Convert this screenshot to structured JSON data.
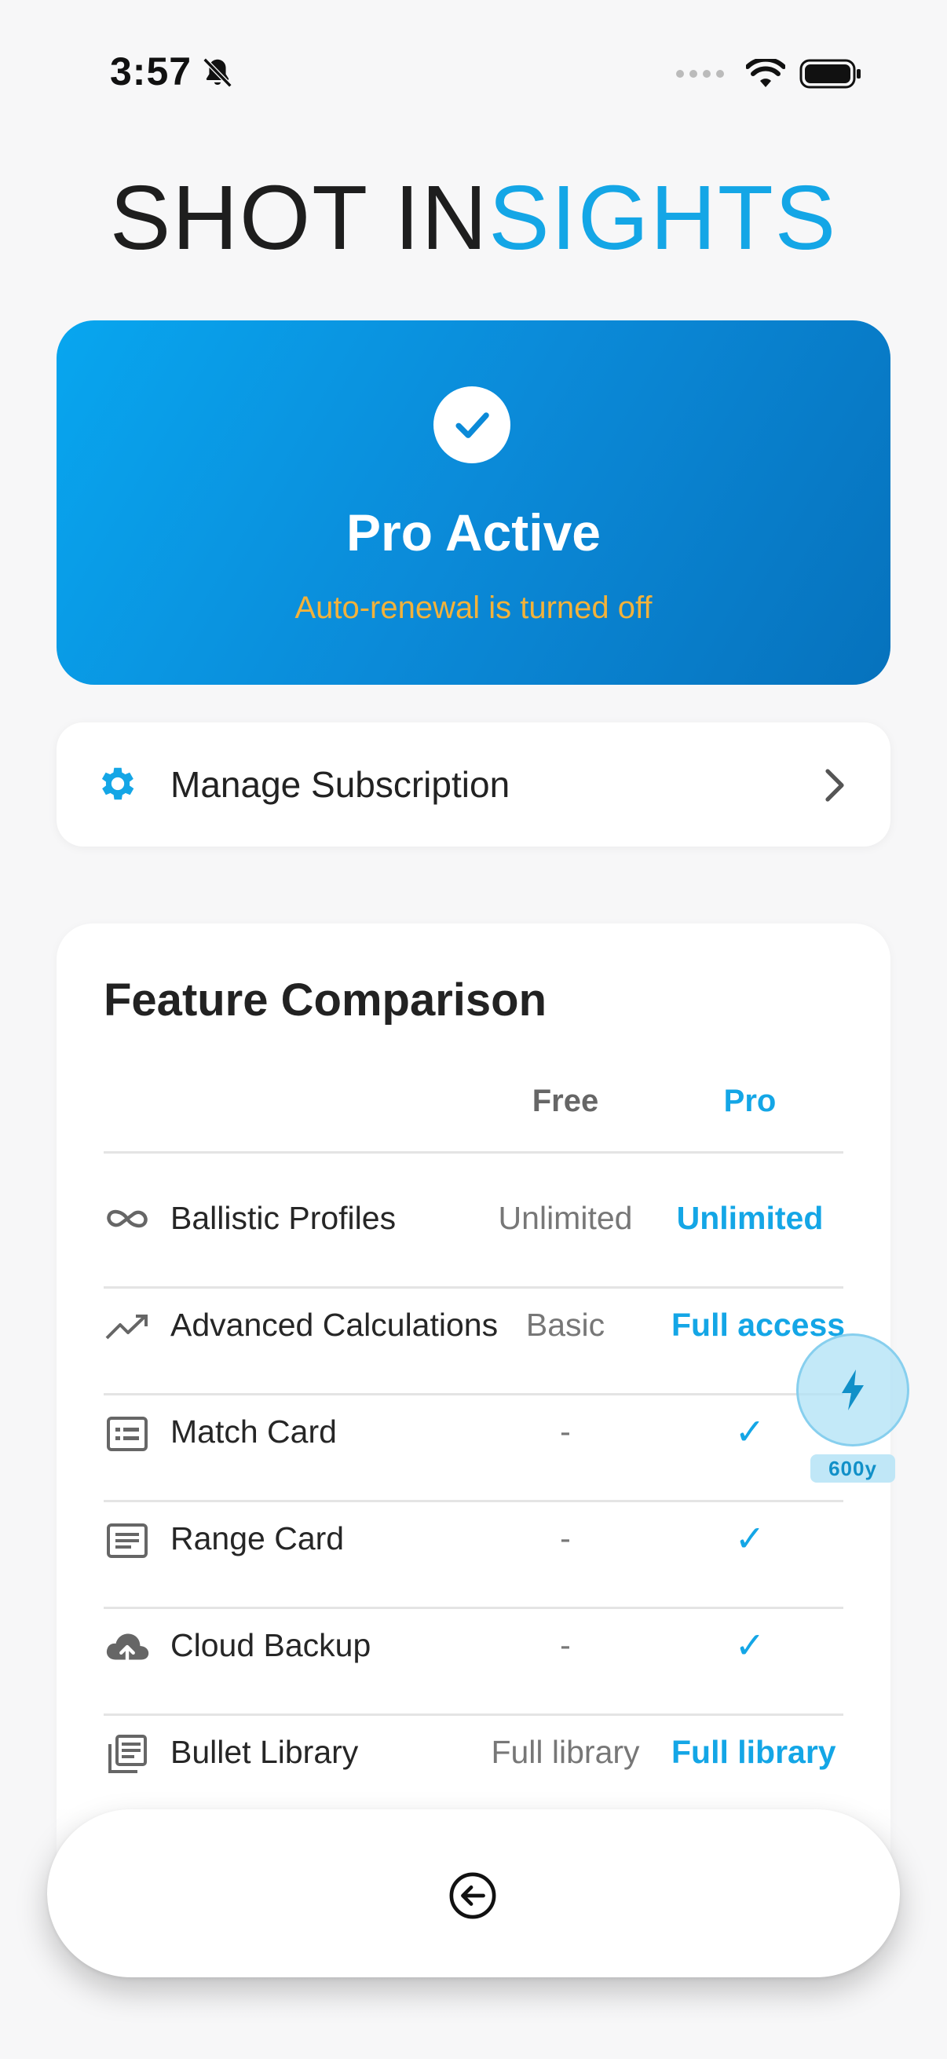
{
  "status_bar": {
    "time": "3:57"
  },
  "brand": {
    "title_part1": "SHOT IN",
    "title_part2": "SIGHTS"
  },
  "pro_card": {
    "title": "Pro Active",
    "subtitle": "Auto-renewal is turned off"
  },
  "manage": {
    "label": "Manage Subscription"
  },
  "comparison": {
    "title": "Feature Comparison",
    "col_free": "Free",
    "col_pro": "Pro",
    "rows": [
      {
        "icon": "infinity-icon",
        "name": "Ballistic Profiles",
        "free": "Unlimited",
        "pro": "Unlimited"
      },
      {
        "icon": "trending-up-icon",
        "name": "Advanced Calculations",
        "free": "Basic",
        "pro": "Full access"
      },
      {
        "icon": "match-card-icon",
        "name": "Match Card",
        "free": "-",
        "pro": "✓"
      },
      {
        "icon": "range-card-icon",
        "name": "Range Card",
        "free": "-",
        "pro": "✓"
      },
      {
        "icon": "cloud-upload-icon",
        "name": "Cloud Backup",
        "free": "-",
        "pro": "✓"
      },
      {
        "icon": "library-icon",
        "name": "Bullet Library",
        "free": "Full library",
        "pro": "Full library"
      }
    ]
  },
  "fab": {
    "badge": "600y"
  },
  "colors": {
    "accent": "#14a6e6",
    "card_gradient_start": "#08a6ef",
    "card_gradient_end": "#0672bd",
    "warning": "#f3b23a"
  }
}
